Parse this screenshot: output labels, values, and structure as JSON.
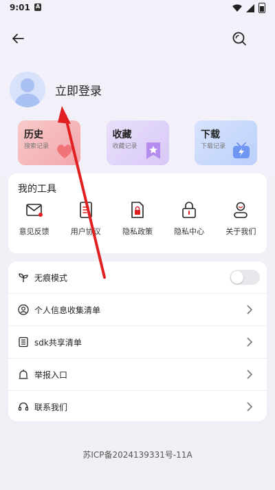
{
  "status": {
    "time": "9:01"
  },
  "login": {
    "label": "立即登录"
  },
  "cards": [
    {
      "title": "历史",
      "sub": "搜索记录",
      "deco_icon": "heart-icon"
    },
    {
      "title": "收藏",
      "sub": "收藏记录",
      "deco_icon": "bookmark-star-icon"
    },
    {
      "title": "下载",
      "sub": "下载记录",
      "deco_icon": "tv-download-icon"
    }
  ],
  "tools": {
    "title": "我的工具",
    "items": [
      {
        "label": "意见反馈",
        "icon": "mail-icon"
      },
      {
        "label": "用户协议",
        "icon": "document-icon"
      },
      {
        "label": "隐私政策",
        "icon": "lock-document-icon"
      },
      {
        "label": "隐私中心",
        "icon": "lock-icon"
      },
      {
        "label": "关于我们",
        "icon": "person-icon"
      }
    ]
  },
  "settings": {
    "items": [
      {
        "label": "无痕模式",
        "icon": "sprout-icon",
        "control": "toggle",
        "toggle_on": false
      },
      {
        "label": "个人信息收集清单",
        "icon": "user-circle-icon",
        "control": "chevron"
      },
      {
        "label": "sdk共享清单",
        "icon": "list-icon",
        "control": "chevron"
      },
      {
        "label": "举报入口",
        "icon": "alarm-icon",
        "control": "chevron"
      },
      {
        "label": "联系我们",
        "icon": "headset-icon",
        "control": "chevron"
      }
    ]
  },
  "footer": {
    "icp": "苏ICP备2024139331号-11A"
  },
  "colors": {
    "accent_red": "#e02020",
    "toggle_off": "#e8e8ec"
  }
}
